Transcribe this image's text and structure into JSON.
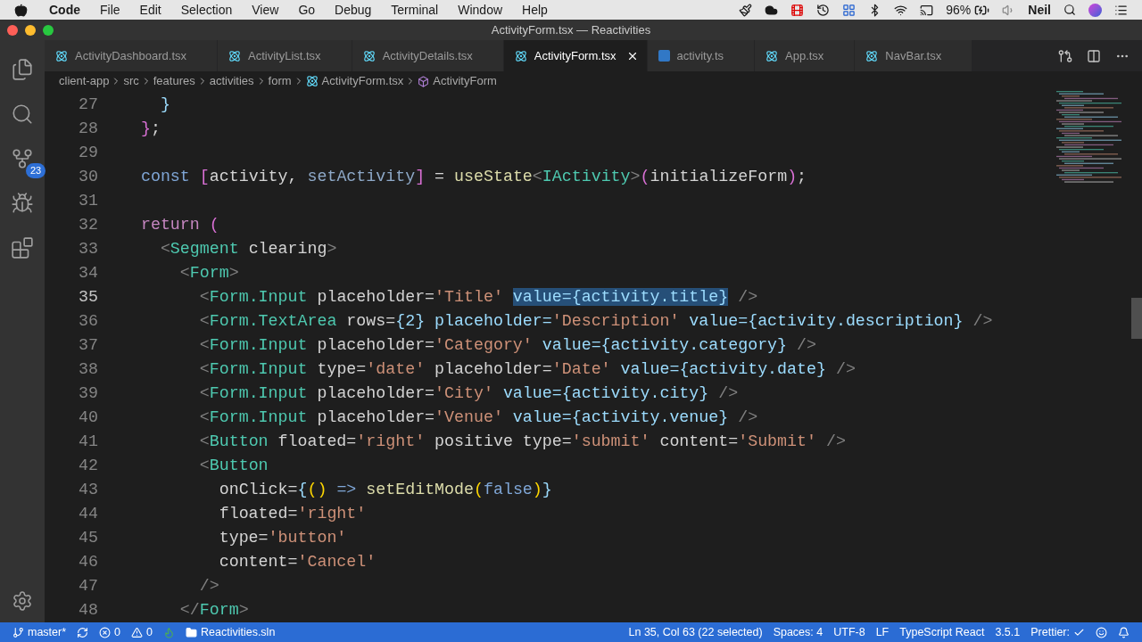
{
  "menubar": {
    "app": "Code",
    "items": [
      "File",
      "Edit",
      "Selection",
      "View",
      "Go",
      "Debug",
      "Terminal",
      "Window",
      "Help"
    ],
    "battery": "96%",
    "user": "Neil"
  },
  "window": {
    "title": "ActivityForm.tsx — Reactivities"
  },
  "activity_bar": {
    "items": [
      {
        "kind": "files"
      },
      {
        "kind": "search"
      },
      {
        "kind": "source-control",
        "badge": "23"
      },
      {
        "kind": "debug"
      },
      {
        "kind": "extensions"
      }
    ]
  },
  "tabs": [
    {
      "label": "ActivityDashboard.tsx",
      "kind": "react",
      "selected": false
    },
    {
      "label": "ActivityList.tsx",
      "kind": "react",
      "selected": false
    },
    {
      "label": "ActivityDetails.tsx",
      "kind": "react",
      "selected": false
    },
    {
      "label": "ActivityForm.tsx",
      "kind": "react",
      "selected": true
    },
    {
      "label": "activity.ts",
      "kind": "ts",
      "selected": false
    },
    {
      "label": "App.tsx",
      "kind": "react",
      "selected": false
    },
    {
      "label": "NavBar.tsx",
      "kind": "react",
      "selected": false
    }
  ],
  "breadcrumbs": [
    {
      "label": "client-app"
    },
    {
      "label": "src"
    },
    {
      "label": "features"
    },
    {
      "label": "activities"
    },
    {
      "label": "form"
    },
    {
      "label": "ActivityForm.tsx",
      "kind": "react"
    },
    {
      "label": "ActivityForm",
      "kind": "symbol"
    }
  ],
  "editor": {
    "lines": [
      {
        "number": "27",
        "current": false,
        "tokens": [
          {
            "text": "    }",
            "kind": "bracket3"
          }
        ]
      },
      {
        "number": "28",
        "current": false,
        "tokens": [
          {
            "text": "  }",
            "kind": "bracket2"
          },
          {
            "text": ";",
            "kind": "plain"
          }
        ]
      },
      {
        "number": "29",
        "current": false
      },
      {
        "number": "30",
        "current": false,
        "tokens": [
          {
            "text": "  const ",
            "kind": "keyword"
          },
          {
            "text": "[",
            "kind": "bracket2"
          },
          {
            "text": "activity, ",
            "kind": "plain"
          },
          {
            "text": "setActivity",
            "kind": "variable"
          },
          {
            "text": "]",
            "kind": "bracket2"
          },
          {
            "text": " = ",
            "kind": "plain"
          },
          {
            "text": "useState",
            "kind": "function"
          },
          {
            "text": "<",
            "kind": "punct"
          },
          {
            "text": "IActivity",
            "kind": "tag"
          },
          {
            "text": ">",
            "kind": "punct"
          },
          {
            "text": "(",
            "kind": "bracket2"
          },
          {
            "text": "initializeForm",
            "kind": "plain"
          },
          {
            "text": ")",
            "kind": "bracket2"
          },
          {
            "text": ";",
            "kind": "plain"
          }
        ]
      },
      {
        "number": "31",
        "current": false
      },
      {
        "number": "32",
        "current": false,
        "tokens": [
          {
            "text": "  return ",
            "kind": "control"
          },
          {
            "text": "(",
            "kind": "bracket2"
          }
        ]
      },
      {
        "number": "33",
        "current": false,
        "tokens": [
          {
            "text": "    <",
            "kind": "punct"
          },
          {
            "text": "Segment",
            "kind": "tag"
          },
          {
            "text": " clearing",
            "kind": "plain"
          },
          {
            "text": ">",
            "kind": "punct"
          }
        ]
      },
      {
        "number": "34",
        "current": false,
        "tokens": [
          {
            "text": "      <",
            "kind": "punct"
          },
          {
            "text": "Form",
            "kind": "tag"
          },
          {
            "text": ">",
            "kind": "punct"
          }
        ]
      },
      {
        "number": "35",
        "current": true,
        "tokens": [
          {
            "text": "        <",
            "kind": "punct"
          },
          {
            "text": "Form.Input",
            "kind": "tag"
          },
          {
            "text": " placeholder=",
            "kind": "plain"
          },
          {
            "text": "'Title' ",
            "kind": "string"
          },
          {
            "text": "value={activity.title}",
            "kind": "selection"
          },
          {
            "text": " />",
            "kind": "punct"
          }
        ]
      },
      {
        "number": "36",
        "current": false,
        "tokens": [
          {
            "text": "        <",
            "kind": "punct"
          },
          {
            "text": "Form.TextArea",
            "kind": "tag"
          },
          {
            "text": " rows=",
            "kind": "plain"
          },
          {
            "text": "{2}",
            "kind": "attr"
          },
          {
            "text": " placeholder=",
            "kind": "attr"
          },
          {
            "text": "'Description'",
            "kind": "string"
          },
          {
            "text": " value=",
            "kind": "attr"
          },
          {
            "text": "{activity.description}",
            "kind": "attr"
          },
          {
            "text": " />",
            "kind": "punct"
          }
        ]
      },
      {
        "number": "37",
        "current": false,
        "tokens": [
          {
            "text": "        <",
            "kind": "punct"
          },
          {
            "text": "Form.Input",
            "kind": "tag"
          },
          {
            "text": " placeholder=",
            "kind": "plain"
          },
          {
            "text": "'Category'",
            "kind": "string"
          },
          {
            "text": " value=",
            "kind": "attr"
          },
          {
            "text": "{activity.category}",
            "kind": "attr"
          },
          {
            "text": " />",
            "kind": "punct"
          }
        ]
      },
      {
        "number": "38",
        "current": false,
        "tokens": [
          {
            "text": "        <",
            "kind": "punct"
          },
          {
            "text": "Form.Input",
            "kind": "tag"
          },
          {
            "text": " type=",
            "kind": "plain"
          },
          {
            "text": "'date'",
            "kind": "string"
          },
          {
            "text": " placeholder=",
            "kind": "plain"
          },
          {
            "text": "'Date'",
            "kind": "string"
          },
          {
            "text": " value=",
            "kind": "attr"
          },
          {
            "text": "{activity.date}",
            "kind": "attr"
          },
          {
            "text": " />",
            "kind": "punct"
          }
        ]
      },
      {
        "number": "39",
        "current": false,
        "tokens": [
          {
            "text": "        <",
            "kind": "punct"
          },
          {
            "text": "Form.Input",
            "kind": "tag"
          },
          {
            "text": " placeholder=",
            "kind": "plain"
          },
          {
            "text": "'City'",
            "kind": "string"
          },
          {
            "text": " value=",
            "kind": "attr"
          },
          {
            "text": "{activity.city}",
            "kind": "attr"
          },
          {
            "text": " />",
            "kind": "punct"
          }
        ]
      },
      {
        "number": "40",
        "current": false,
        "tokens": [
          {
            "text": "        <",
            "kind": "punct"
          },
          {
            "text": "Form.Input",
            "kind": "tag"
          },
          {
            "text": " placeholder=",
            "kind": "plain"
          },
          {
            "text": "'Venue'",
            "kind": "string"
          },
          {
            "text": " value=",
            "kind": "attr"
          },
          {
            "text": "{activity.venue}",
            "kind": "attr"
          },
          {
            "text": " />",
            "kind": "punct"
          }
        ]
      },
      {
        "number": "41",
        "current": false,
        "tokens": [
          {
            "text": "        <",
            "kind": "punct"
          },
          {
            "text": "Button",
            "kind": "tag"
          },
          {
            "text": " floated=",
            "kind": "plain"
          },
          {
            "text": "'right'",
            "kind": "string"
          },
          {
            "text": " positive type=",
            "kind": "plain"
          },
          {
            "text": "'submit'",
            "kind": "string"
          },
          {
            "text": " content=",
            "kind": "plain"
          },
          {
            "text": "'Submit'",
            "kind": "string"
          },
          {
            "text": " />",
            "kind": "punct"
          }
        ]
      },
      {
        "number": "42",
        "current": false,
        "tokens": [
          {
            "text": "        <",
            "kind": "punct"
          },
          {
            "text": "Button",
            "kind": "tag"
          }
        ]
      },
      {
        "number": "43",
        "current": false,
        "tokens": [
          {
            "text": "          onClick=",
            "kind": "plain"
          },
          {
            "text": "{",
            "kind": "attr"
          },
          {
            "text": "()",
            "kind": "bracket1"
          },
          {
            "text": " => ",
            "kind": "keyword"
          },
          {
            "text": "setEditMode",
            "kind": "function"
          },
          {
            "text": "(",
            "kind": "bracket1"
          },
          {
            "text": "false",
            "kind": "keyword"
          },
          {
            "text": ")",
            "kind": "bracket1"
          },
          {
            "text": "}",
            "kind": "attr"
          }
        ]
      },
      {
        "number": "44",
        "current": false,
        "tokens": [
          {
            "text": "          floated=",
            "kind": "plain"
          },
          {
            "text": "'right'",
            "kind": "string"
          }
        ]
      },
      {
        "number": "45",
        "current": false,
        "tokens": [
          {
            "text": "          type=",
            "kind": "plain"
          },
          {
            "text": "'button'",
            "kind": "string"
          }
        ]
      },
      {
        "number": "46",
        "current": false,
        "tokens": [
          {
            "text": "          content=",
            "kind": "plain"
          },
          {
            "text": "'Cancel'",
            "kind": "string"
          }
        ]
      },
      {
        "number": "47",
        "current": false,
        "tokens": [
          {
            "text": "        />",
            "kind": "punct"
          }
        ]
      },
      {
        "number": "48",
        "current": false,
        "tokens": [
          {
            "text": "      </",
            "kind": "punct"
          },
          {
            "text": "Form",
            "kind": "tag"
          },
          {
            "text": ">",
            "kind": "punct"
          }
        ]
      }
    ]
  },
  "status_bar": {
    "left": [
      {
        "kind": "branch",
        "text": "master*"
      },
      {
        "kind": "sync"
      },
      {
        "kind": "errors",
        "text": "0"
      },
      {
        "kind": "warnings",
        "text": "0"
      },
      {
        "kind": "flame"
      },
      {
        "kind": "folder",
        "text": "Reactivities.sln"
      }
    ],
    "right": [
      {
        "kind": "text",
        "text": "Ln 35, Col 63 (22 selected)"
      },
      {
        "kind": "text",
        "text": "Spaces: 4"
      },
      {
        "kind": "text",
        "text": "UTF-8"
      },
      {
        "kind": "text",
        "text": "LF"
      },
      {
        "kind": "text",
        "text": "TypeScript React"
      },
      {
        "kind": "text",
        "text": "3.5.1"
      },
      {
        "kind": "prettier",
        "text": "Prettier:"
      },
      {
        "kind": "feedback"
      },
      {
        "kind": "bell"
      }
    ]
  }
}
